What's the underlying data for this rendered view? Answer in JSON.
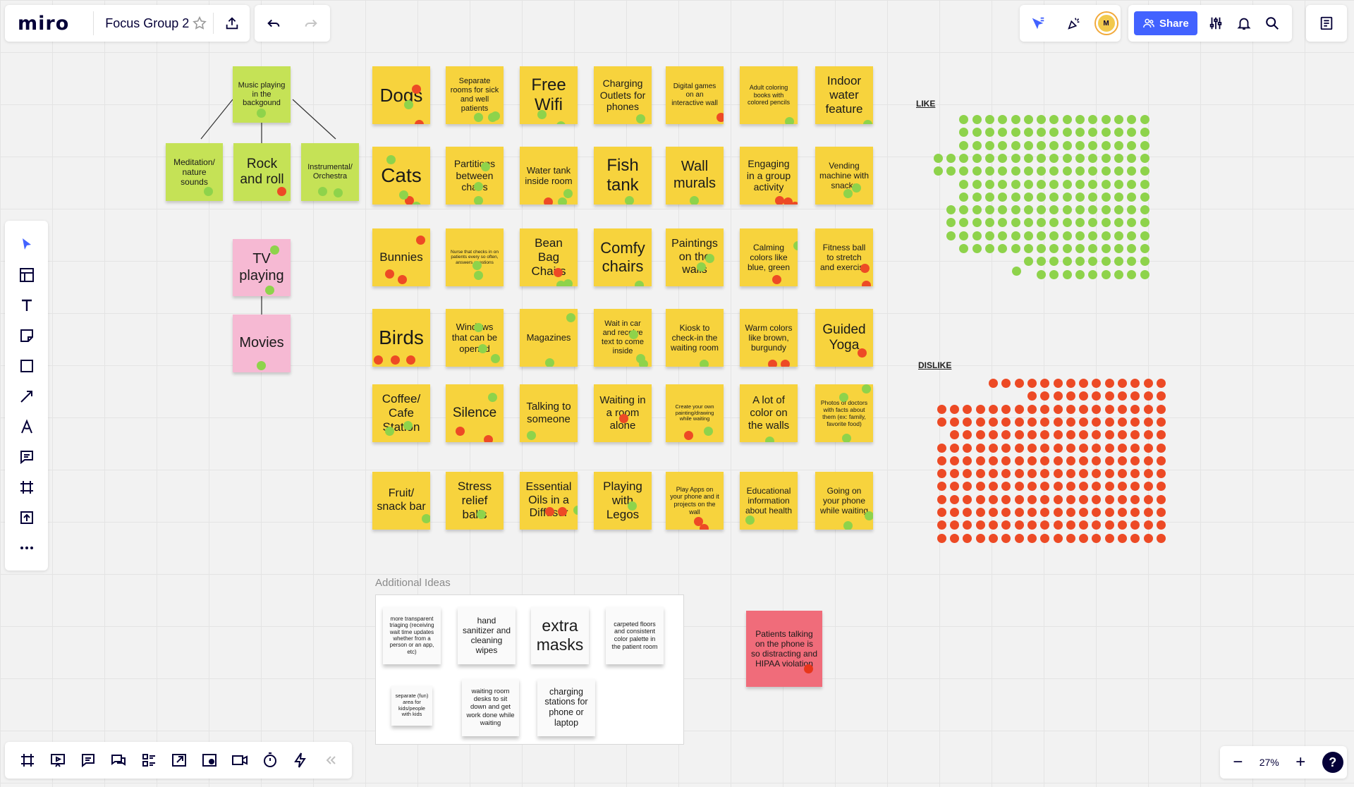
{
  "app": {
    "logo": "miro",
    "board_title": "Focus Group 2"
  },
  "topbar": {
    "share_label": "Share",
    "avatar_initial": "M"
  },
  "zoom": {
    "level": "27%",
    "help": "?"
  },
  "colors": {
    "accent": "#4262ff",
    "like_dot": "#8ed34b",
    "dislike_dot": "#ed4a25"
  },
  "sections": {
    "like": "LIKE",
    "dislike": "DISLIKE",
    "additional": "Additional Ideas"
  },
  "music_tree": {
    "root": "Music playing in the backgound",
    "children": [
      "Meditation/ nature sounds",
      "Rock and roll",
      "Instrumental/ Orchestra"
    ]
  },
  "tv_tree": {
    "root": "TV playing",
    "child": "Movies"
  },
  "grid_notes": [
    [
      "Dogs",
      "Separate rooms for sick and well patients",
      "Free Wifi",
      "Charging Outlets for phones",
      "Digital games on an interactive wall",
      "Adult coloring books with colored pencils",
      "Indoor water feature"
    ],
    [
      "Cats",
      "Partitions between chairs",
      "Water tank inside room",
      "Fish tank",
      "Wall murals",
      "Engaging in a group activity",
      "Vending machine with snacks"
    ],
    [
      "Bunnies",
      "Nurse that checks in on patients every so often, answers questions",
      "Bean Bag Chairs",
      "Comfy chairs",
      "Paintings on the walls",
      "Calming colors like blue, green",
      "Fitness ball to stretch and exercise"
    ],
    [
      "Birds",
      "Windows that can be opened",
      "Magazines",
      "Wait in car and receive text to come inside",
      "Kiosk to check-in the waiting room",
      "Warm colors like brown, burgundy",
      "Guided Yoga"
    ],
    [
      "Coffee/ Cafe Station",
      "Silence",
      "Talking to someone",
      "Waiting in a room alone",
      "Create your own painting/drawing while waiting",
      "A lot of color on the walls",
      "Photos of doctors with facts about them (ex: family, favorite food)"
    ],
    [
      "Fruit/ snack bar",
      "Stress relief balls",
      "Essential Oils in a Diffuser",
      "Playing with Legos",
      "Play Apps on your phone and it projects on the wall",
      "Educational information about health",
      "Going on your phone while waiting"
    ]
  ],
  "additional_ideas": [
    "more transparent triaging (receiving wait time updates whether from a person or an app, etc)",
    "hand sanitizer and cleaning wipes",
    "extra masks",
    "carpeted floors and consistent color palette in the patient room",
    "separate (fun) area for kids/people with kids",
    "waiting room desks to sit down and get work done while waiting",
    "charging stations for phone or laptop"
  ],
  "red_note": "Patients talking on the phone is so distracting and HIPAA violation"
}
